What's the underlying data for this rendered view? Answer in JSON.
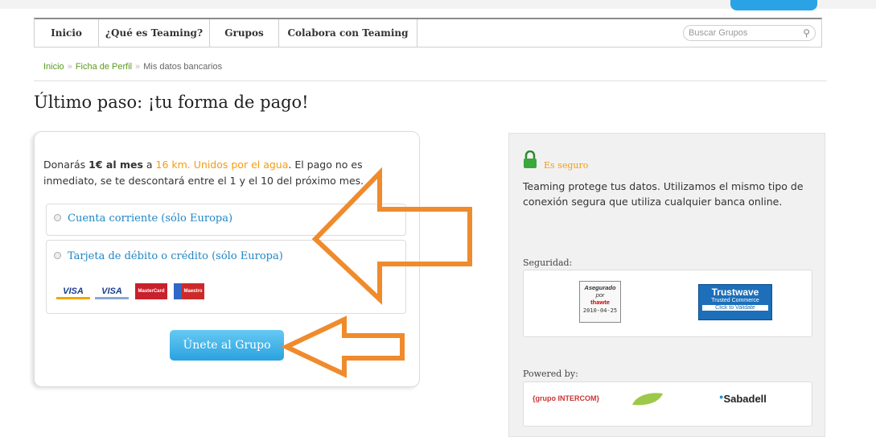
{
  "nav": {
    "items": [
      {
        "label": "Inicio"
      },
      {
        "label": "¿Qué es Teaming?"
      },
      {
        "label": "Grupos"
      },
      {
        "label": "Colabora con Teaming"
      }
    ],
    "search_placeholder": "Buscar Grupos",
    "search_icon": "magnifier-icon"
  },
  "breadcrumb": {
    "items": [
      "Inicio",
      "Ficha de Perfil",
      "Mis datos bancarios"
    ],
    "separator": "»"
  },
  "page": {
    "title": "Último paso: ¡tu forma de pago!"
  },
  "payment": {
    "text_1": "Donarás ",
    "amount": "1€ al mes",
    "text_2": " a ",
    "group_name": "16 km. Unidos por el agua",
    "text_3": ". El pago no es inmediato, se te descontará entre el 1 y el 10 del próximo mes.",
    "options": [
      {
        "label": "Cuenta corriente (sólo Europa)"
      },
      {
        "label": "Tarjeta de débito o crédito  (sólo Europa)"
      }
    ],
    "card_logos": [
      "VISA",
      "VISA",
      "MasterCard",
      "Maestro"
    ],
    "submit_label": "Únete al Grupo"
  },
  "security": {
    "title": "Es seguro",
    "text": "Teaming protege tus datos. Utilizamos el mismo tipo de conexión segura que utiliza cualquier banca online.",
    "section_label": "Seguridad:",
    "seal1": {
      "line1": "Asegurado",
      "line2": "por",
      "line3": "thawte",
      "date": "2010-04-25"
    },
    "seal2": {
      "title": "Trustwave",
      "subtitle": "Trusted Commerce",
      "cta": "Click to Validate"
    },
    "powered_label": "Powered by:",
    "partners": [
      "{grupo INTERCOM}",
      "Sabadell"
    ]
  },
  "colors": {
    "accent_blue": "#29a3e6",
    "link_green": "#5a9a1e",
    "highlight_orange": "#f39c12",
    "arrow_orange": "#ef8b2c"
  }
}
